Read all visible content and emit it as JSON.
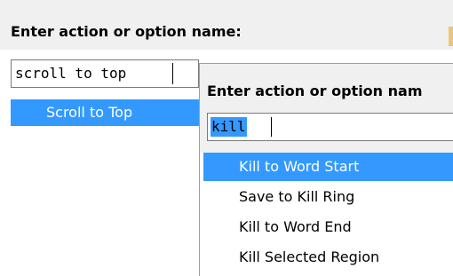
{
  "colors": {
    "selection": "#3399ff",
    "header_bg": "#f0f0f0",
    "border": "#7a7a7a"
  },
  "back_popup": {
    "title": "Enter action or option name:",
    "input_value": "scroll to top",
    "results": [
      {
        "label": "Scroll to Top",
        "selected": true
      }
    ]
  },
  "front_popup": {
    "title": "Enter action or option nam",
    "input_value": "kill",
    "results": [
      {
        "label": "Kill to Word Start",
        "selected": true
      },
      {
        "label": "Save to Kill Ring",
        "selected": false
      },
      {
        "label": "Kill to Word End",
        "selected": false
      },
      {
        "label": "Kill Selected Region",
        "selected": false
      }
    ]
  }
}
